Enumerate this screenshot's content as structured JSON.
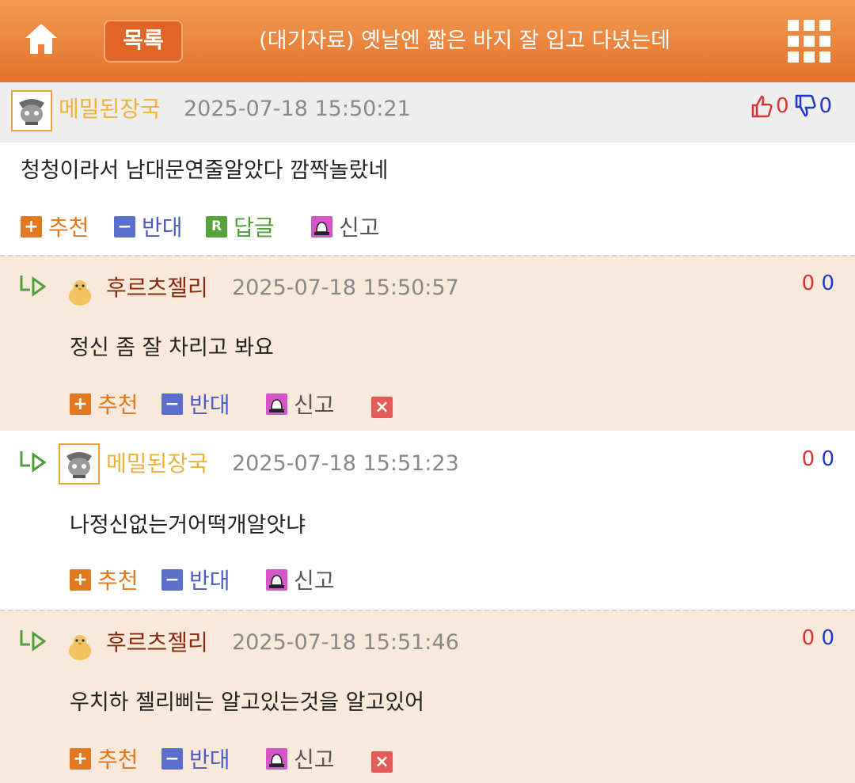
{
  "header": {
    "list_label": "목록",
    "title": "(대기자료) 옛날엔 짧은 바지 잘 입고 다녔는데",
    "home_icon": "home-icon",
    "menu_icon": "grid-menu-icon"
  },
  "post": {
    "nick": "메밀된장국",
    "datetime": "2025-07-18 15:50:21",
    "likes": "0",
    "dislikes": "0",
    "content": "청청이라서 남대문연줄알았다 깜짝놀랐네",
    "actions": {
      "recommend": "추천",
      "oppose": "반대",
      "reply": "답글",
      "reply_badge": "R",
      "report": "신고"
    }
  },
  "comments": [
    {
      "nick": "후르츠젤리",
      "datetime": "2025-07-18 15:50:57",
      "up": "0",
      "down": "0",
      "text": "정신 좀 잘 차리고 봐요",
      "recommend": "추천",
      "oppose": "반대",
      "report": "신고"
    },
    {
      "nick": "메밀된장국",
      "datetime": "2025-07-18 15:51:23",
      "up": "0",
      "down": "0",
      "text": "나정신없는거어떡개알앗냐",
      "recommend": "추천",
      "oppose": "반대",
      "report": "신고"
    },
    {
      "nick": "후르츠젤리",
      "datetime": "2025-07-18 15:51:46",
      "up": "0",
      "down": "0",
      "text": "우치하 젤리삐는 알고있는것을 알고있어",
      "recommend": "추천",
      "oppose": "반대",
      "report": "신고"
    }
  ],
  "colors": {
    "header_top": "#f39a52",
    "header_bottom": "#e4732c",
    "nick_author": "#f0b13a",
    "nick_other": "#8a2a14",
    "comment_bg": "#f8e9da"
  }
}
